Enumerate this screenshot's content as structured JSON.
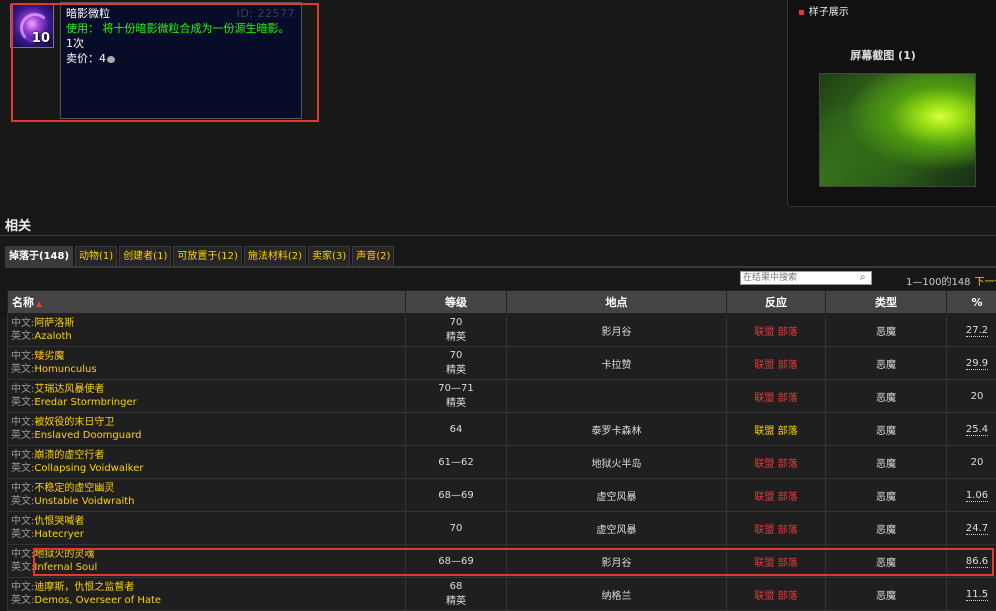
{
  "item": {
    "stack_count": "10",
    "name": "暗影微粒",
    "id_text": "ID: 22577",
    "use_text": "使用：  将十份暗影微粒合成为一份源生暗影。",
    "charges": "1次",
    "sell_label": "卖价：",
    "sell_value": "4"
  },
  "right_panel": {
    "sample_link": "样子展示",
    "screenshot_title": "屏幕截图 (1)"
  },
  "related": {
    "title": "相关",
    "tabs": [
      "掉落于(148)",
      "动物(1)",
      "创建者(1)",
      "可放置于(12)",
      "施法材料(2)",
      "卖家(3)",
      "声音(2)"
    ],
    "search_placeholder": "在结果中搜索",
    "pager_range": "1—100的148",
    "pager_next": "下一个"
  },
  "table": {
    "headers": {
      "name": "名称",
      "level": "等级",
      "location": "地点",
      "reaction": "反应",
      "type": "类型",
      "percent": "%"
    },
    "cn_label": "中文:",
    "en_label": "英文:",
    "alliance": "联盟",
    "horde": "部落",
    "rows": [
      {
        "cn": "阿萨洛斯",
        "en": "Azaloth",
        "level": "70",
        "level_sub": "精英",
        "location": "影月谷",
        "react": "red",
        "type": "恶魔",
        "pct": "27.2"
      },
      {
        "cn": "矮劣魔",
        "en": "Homunculus",
        "level": "70",
        "level_sub": "精英",
        "location": "卡拉赞",
        "react": "red",
        "type": "恶魔",
        "pct": "29.9"
      },
      {
        "cn": "艾瑞达风暴使者",
        "en": "Eredar Stormbringer",
        "level": "70—71",
        "level_sub": "精英",
        "location": "",
        "react": "red",
        "type": "恶魔",
        "pct": "20"
      },
      {
        "cn": "被奴役的末日守卫",
        "en": "Enslaved Doomguard",
        "level": "64",
        "level_sub": "",
        "location": "泰罗卡森林",
        "react": "yellow",
        "type": "恶魔",
        "pct": "25.4"
      },
      {
        "cn": "崩溃的虚空行者",
        "en": "Collapsing Voidwalker",
        "level": "61—62",
        "level_sub": "",
        "location": "地狱火半岛",
        "react": "red",
        "type": "恶魔",
        "pct": "20"
      },
      {
        "cn": "不稳定的虚空幽灵",
        "en": "Unstable Voidwraith",
        "level": "68—69",
        "level_sub": "",
        "location": "虚空风暴",
        "react": "red",
        "type": "恶魔",
        "pct": "1.06"
      },
      {
        "cn": "仇恨哭喊者",
        "en": "Hatecryer",
        "level": "70",
        "level_sub": "",
        "location": "虚空风暴",
        "react": "red",
        "type": "恶魔",
        "pct": "24.7"
      },
      {
        "cn": "地狱火的灵魂",
        "en": "Infernal Soul",
        "level": "68—69",
        "level_sub": "",
        "location": "影月谷",
        "react": "red",
        "type": "恶魔",
        "pct": "86.6"
      },
      {
        "cn": "迪摩斯，仇恨之监督者",
        "en": "Demos, Overseer of Hate",
        "level": "68",
        "level_sub": "精英",
        "location": "纳格兰",
        "react": "red",
        "type": "恶魔",
        "pct": "11.5"
      }
    ]
  },
  "colors": {
    "accent_yellow": "#ffd100",
    "reaction_red": "#e03c3c",
    "use_green": "#1eff00",
    "highlight_red": "#e0392f"
  }
}
